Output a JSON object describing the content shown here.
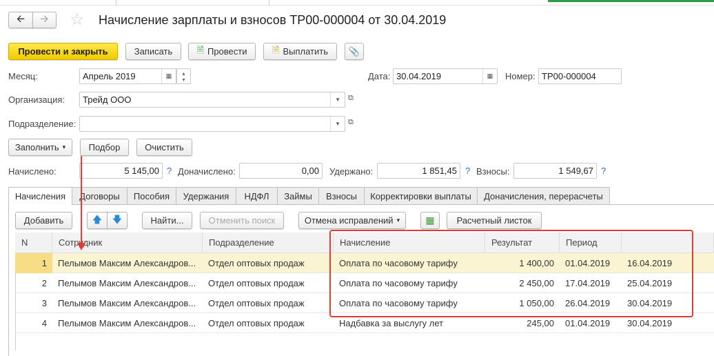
{
  "header": {
    "title": "Начисление зарплаты и взносов ТР00-000004 от 30.04.2019"
  },
  "toolbar": {
    "post_close": "Провести и закрыть",
    "save": "Записать",
    "post": "Провести",
    "pay": "Выплатить"
  },
  "form": {
    "month_label": "Месяц:",
    "month": "Апрель 2019",
    "date_label": "Дата:",
    "date": "30.04.2019",
    "number_label": "Номер:",
    "number": "ТР00-000004",
    "org_label": "Организация:",
    "org": "Трейд ООО",
    "dept_label": "Подразделение:",
    "dept": "",
    "fill": "Заполнить",
    "pick": "Подбор",
    "clear": "Очистить",
    "accrued_label": "Начислено:",
    "accrued": "5 145,00",
    "extra_label": "Доначислено:",
    "extra": "0,00",
    "withheld_label": "Удержано:",
    "withheld": "1 851,45",
    "contrib_label": "Взносы:",
    "contrib": "1 549,67",
    "help": "?"
  },
  "tabs": [
    "Начисления",
    "Договоры",
    "Пособия",
    "Удержания",
    "НДФЛ",
    "Займы",
    "Взносы",
    "Корректировки выплаты",
    "Доначисления, перерасчеты"
  ],
  "table_toolbar": {
    "add": "Добавить",
    "find": "Найти...",
    "cancel_search": "Отменить поиск",
    "cancel_fix": "Отмена исправлений",
    "payslip": "Расчетный листок"
  },
  "table": {
    "columns": [
      "N",
      "Сотрудник",
      "Подразделение",
      "Начисление",
      "Результат",
      "Период",
      ""
    ],
    "rows": [
      [
        "1",
        "Пелымов Максим Александров...",
        "Отдел оптовых продаж",
        "Оплата по часовому тарифу",
        "1 400,00",
        "01.04.2019",
        "16.04.2019"
      ],
      [
        "2",
        "Пелымов Максим Александров...",
        "Отдел оптовых продаж",
        "Оплата по часовому тарифу",
        "2 450,00",
        "17.04.2019",
        "25.04.2019"
      ],
      [
        "3",
        "Пелымов Максим Александров...",
        "Отдел оптовых продаж",
        "Оплата по часовому тарифу",
        "1 050,00",
        "26.04.2019",
        "30.04.2019"
      ],
      [
        "4",
        "Пелымов Максим Александров...",
        "Отдел оптовых продаж",
        "Надбавка за выслугу лет",
        "245,00",
        "01.04.2019",
        "30.04.2019"
      ]
    ]
  },
  "colors": {
    "accent": "#f2cc00",
    "highlight": "#e53935",
    "selected_row": "#fbf4d3"
  }
}
